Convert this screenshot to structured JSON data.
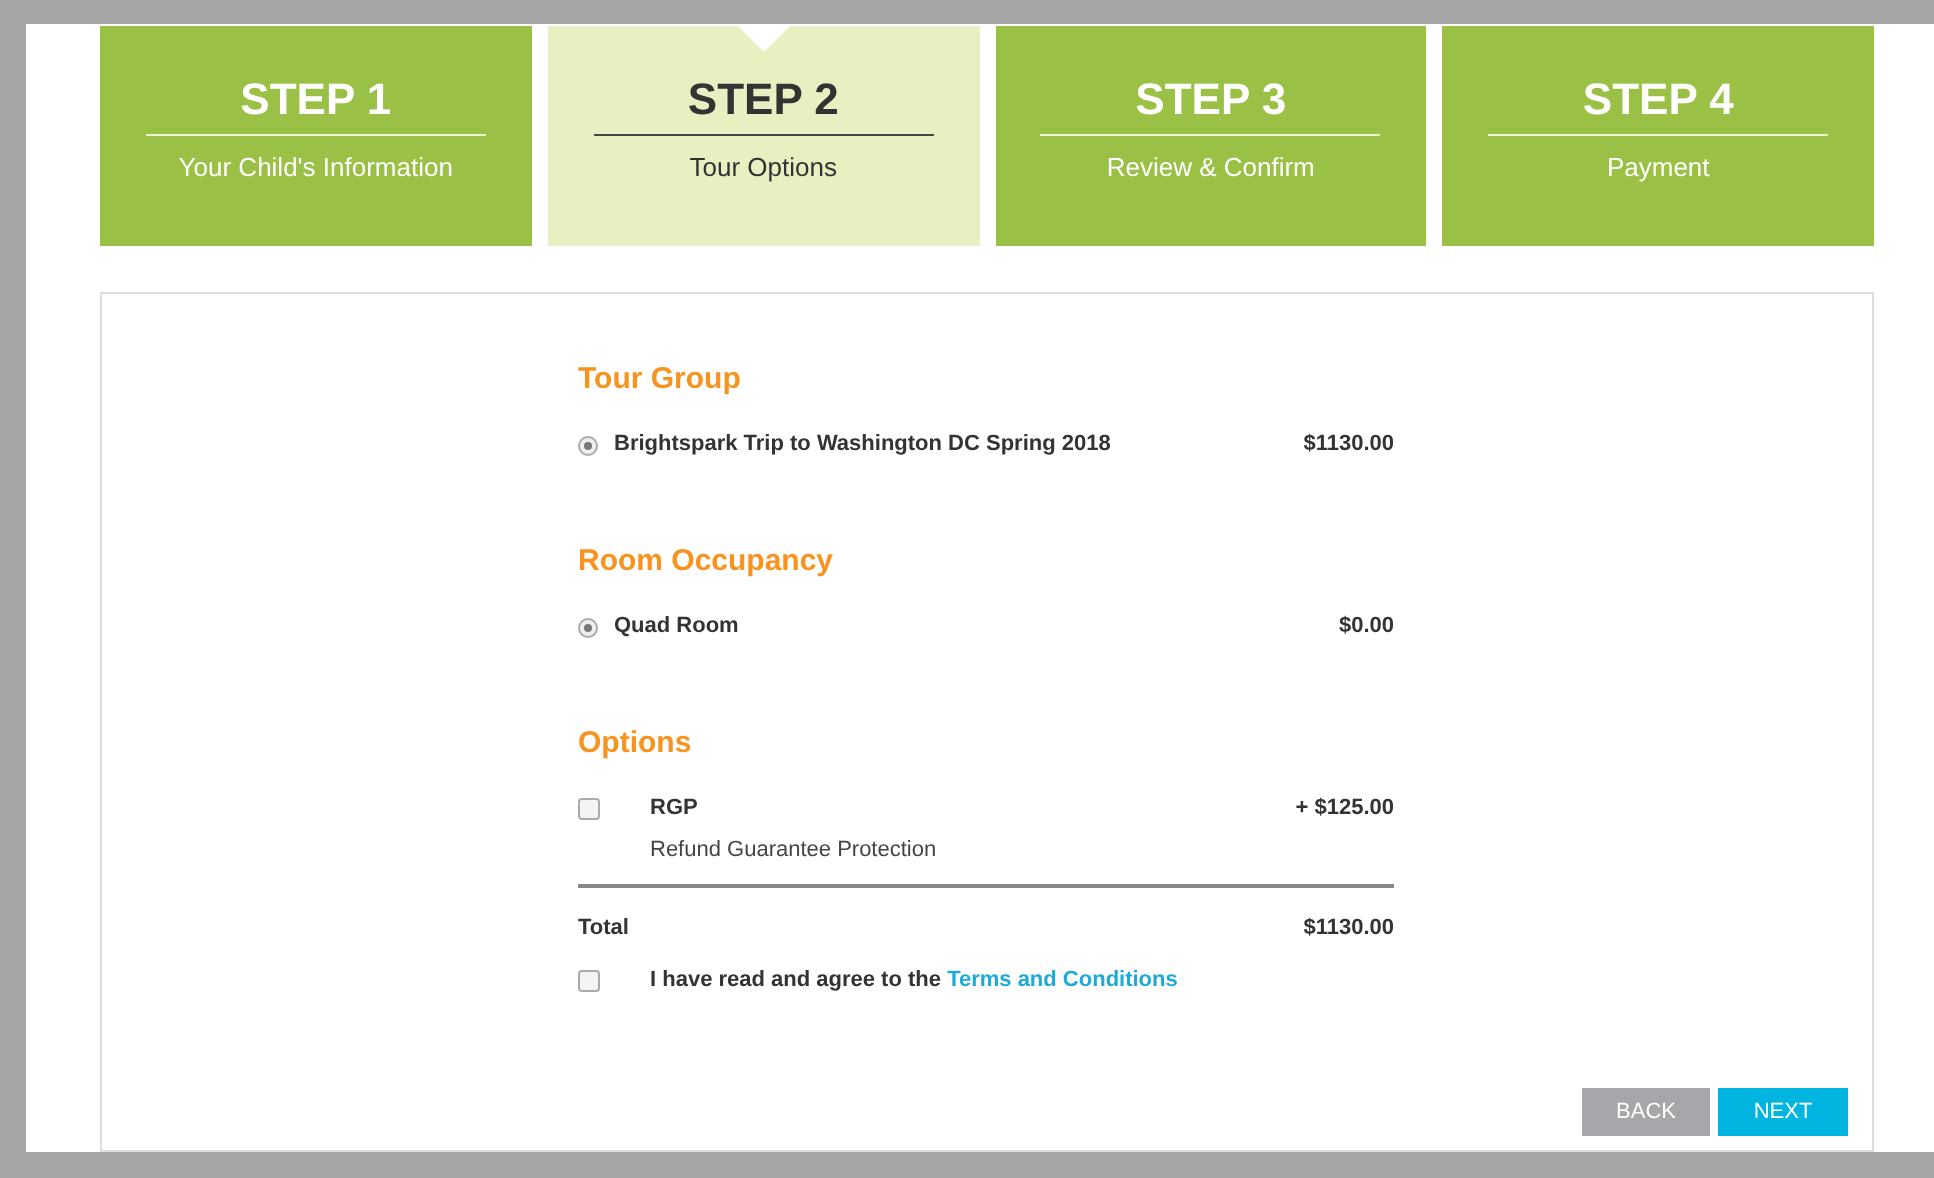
{
  "steps": [
    {
      "title": "STEP 1",
      "label": "Your Child's Information",
      "selected": false
    },
    {
      "title": "STEP 2",
      "label": "Tour Options",
      "selected": true
    },
    {
      "title": "STEP 3",
      "label": "Review & Confirm",
      "selected": false
    },
    {
      "title": "STEP 4",
      "label": "Payment",
      "selected": false
    }
  ],
  "sections": [
    {
      "heading": "Tour Group",
      "kind": "radio",
      "items": [
        {
          "label": "Brightspark Trip to Washington DC Spring 2018",
          "price": "$1130.00",
          "selected": true
        }
      ]
    },
    {
      "heading": "Room Occupancy",
      "kind": "radio",
      "items": [
        {
          "label": "Quad Room",
          "price": "$0.00",
          "selected": true
        }
      ]
    },
    {
      "heading": "Options",
      "kind": "checkbox",
      "items": [
        {
          "label": "RGP",
          "description": "Refund Guarantee Protection",
          "price": "+ $125.00",
          "checked": false
        }
      ]
    }
  ],
  "total": {
    "label": "Total",
    "value": "$1130.00"
  },
  "agreement": {
    "text": "I have read and agree to the",
    "link": "Terms and Conditions",
    "checked": false
  },
  "buttons": [
    {
      "label": "BACK",
      "kind": "secondary"
    },
    {
      "label": "NEXT",
      "kind": "primary"
    }
  ]
}
